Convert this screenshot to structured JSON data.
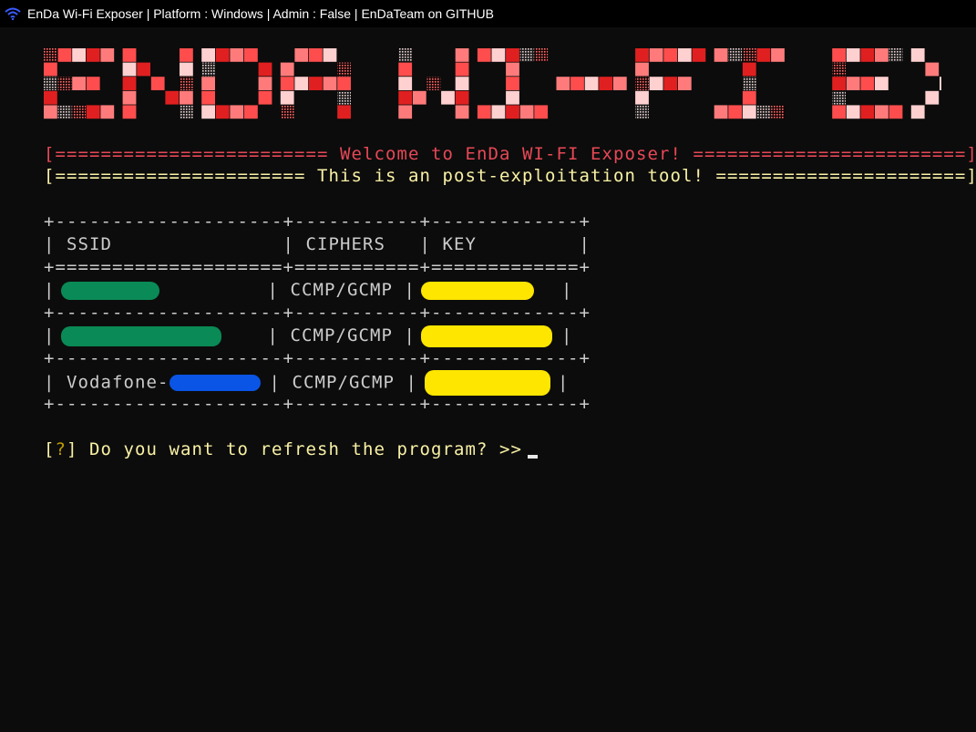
{
  "window": {
    "title": "EnDa Wi-Fi Exposer | Platform : Windows | Admin : False | EnDaTeam on GITHUB",
    "icon": "wifi-icon"
  },
  "banner": {
    "text": "EnDa Wi-Fi Exposer",
    "colors": [
      "#ff7b7b",
      "#ff4d4d",
      "#ffd0d0",
      "#e02020"
    ]
  },
  "welcome_line": "[======================== Welcome to EnDa WI-FI Exposer! ========================]",
  "subtitle_line": "[====================== This is an post-exploitation tool! ======================]",
  "table": {
    "border_line": "+--------------------+-----------+-------------+",
    "separator_line": "+====================+===========+=============+",
    "header_row": "| SSID               | CIPHERS   | KEY         |",
    "rows": [
      {
        "ssid_prefix": "",
        "cipher": "CCMP/GCMP",
        "ssid_redact_color": "#0a8a56",
        "key_redact_color": "#ffe600"
      },
      {
        "ssid_prefix": "",
        "cipher": "CCMP/GCMP",
        "ssid_redact_color": "#0a8a56",
        "key_redact_color": "#ffe600"
      },
      {
        "ssid_prefix": "Vodafone-",
        "cipher": "CCMP/GCMP",
        "ssid_redact_color": "#0a54e6",
        "key_redact_color": "#ffe600"
      }
    ]
  },
  "prompt": {
    "open_bracket": "[",
    "mark": "?",
    "close_bracket": "]",
    "text": " Do you want to refresh the program? >>"
  }
}
